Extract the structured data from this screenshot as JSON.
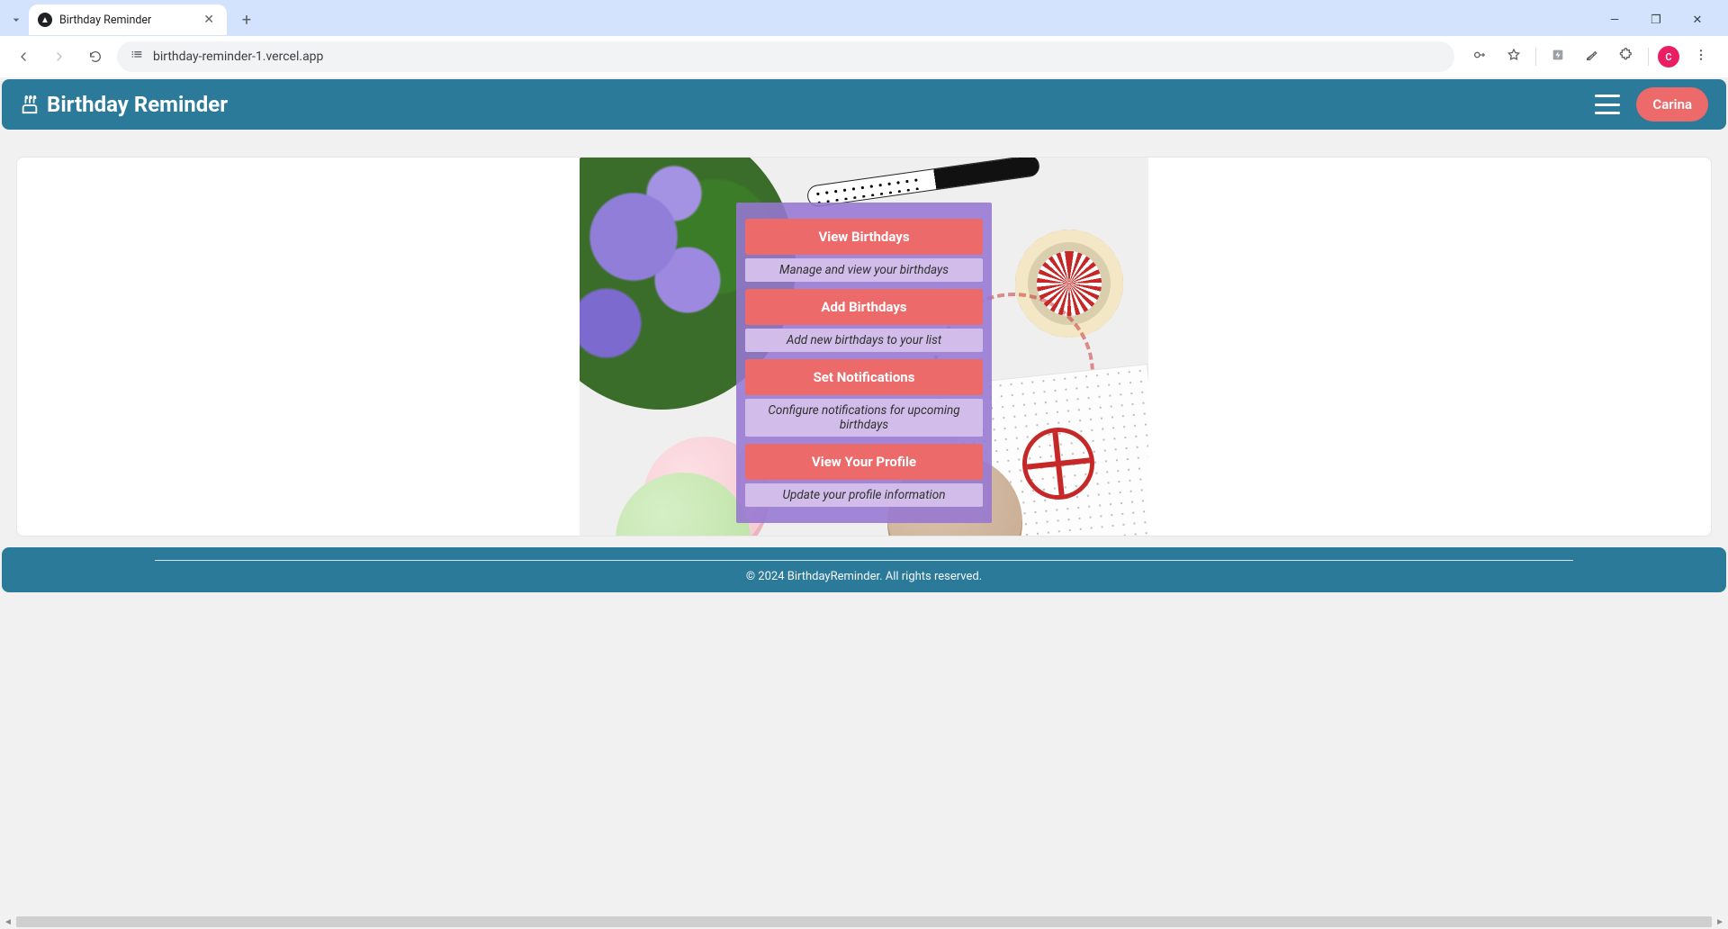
{
  "browser": {
    "tab_title": "Birthday Reminder",
    "url": "birthday-reminder-1.vercel.app",
    "avatar_initial": "C"
  },
  "header": {
    "brand": "Birthday Reminder",
    "user_name": "Carina"
  },
  "menu": {
    "items": [
      {
        "label": "View Birthdays",
        "desc": "Manage and view your birthdays"
      },
      {
        "label": "Add Birthdays",
        "desc": "Add new birthdays to your list"
      },
      {
        "label": "Set Notifications",
        "desc": "Configure notifications for upcoming birthdays"
      },
      {
        "label": "View Your Profile",
        "desc": "Update your profile information"
      }
    ]
  },
  "footer": {
    "copyright": "© 2024 BirthdayReminder. All rights reserved."
  },
  "colors": {
    "brand_teal": "#2b7a99",
    "accent_coral": "#ed6a6a",
    "panel_purple": "#9676d2",
    "panel_lilac": "#d2bdea"
  }
}
